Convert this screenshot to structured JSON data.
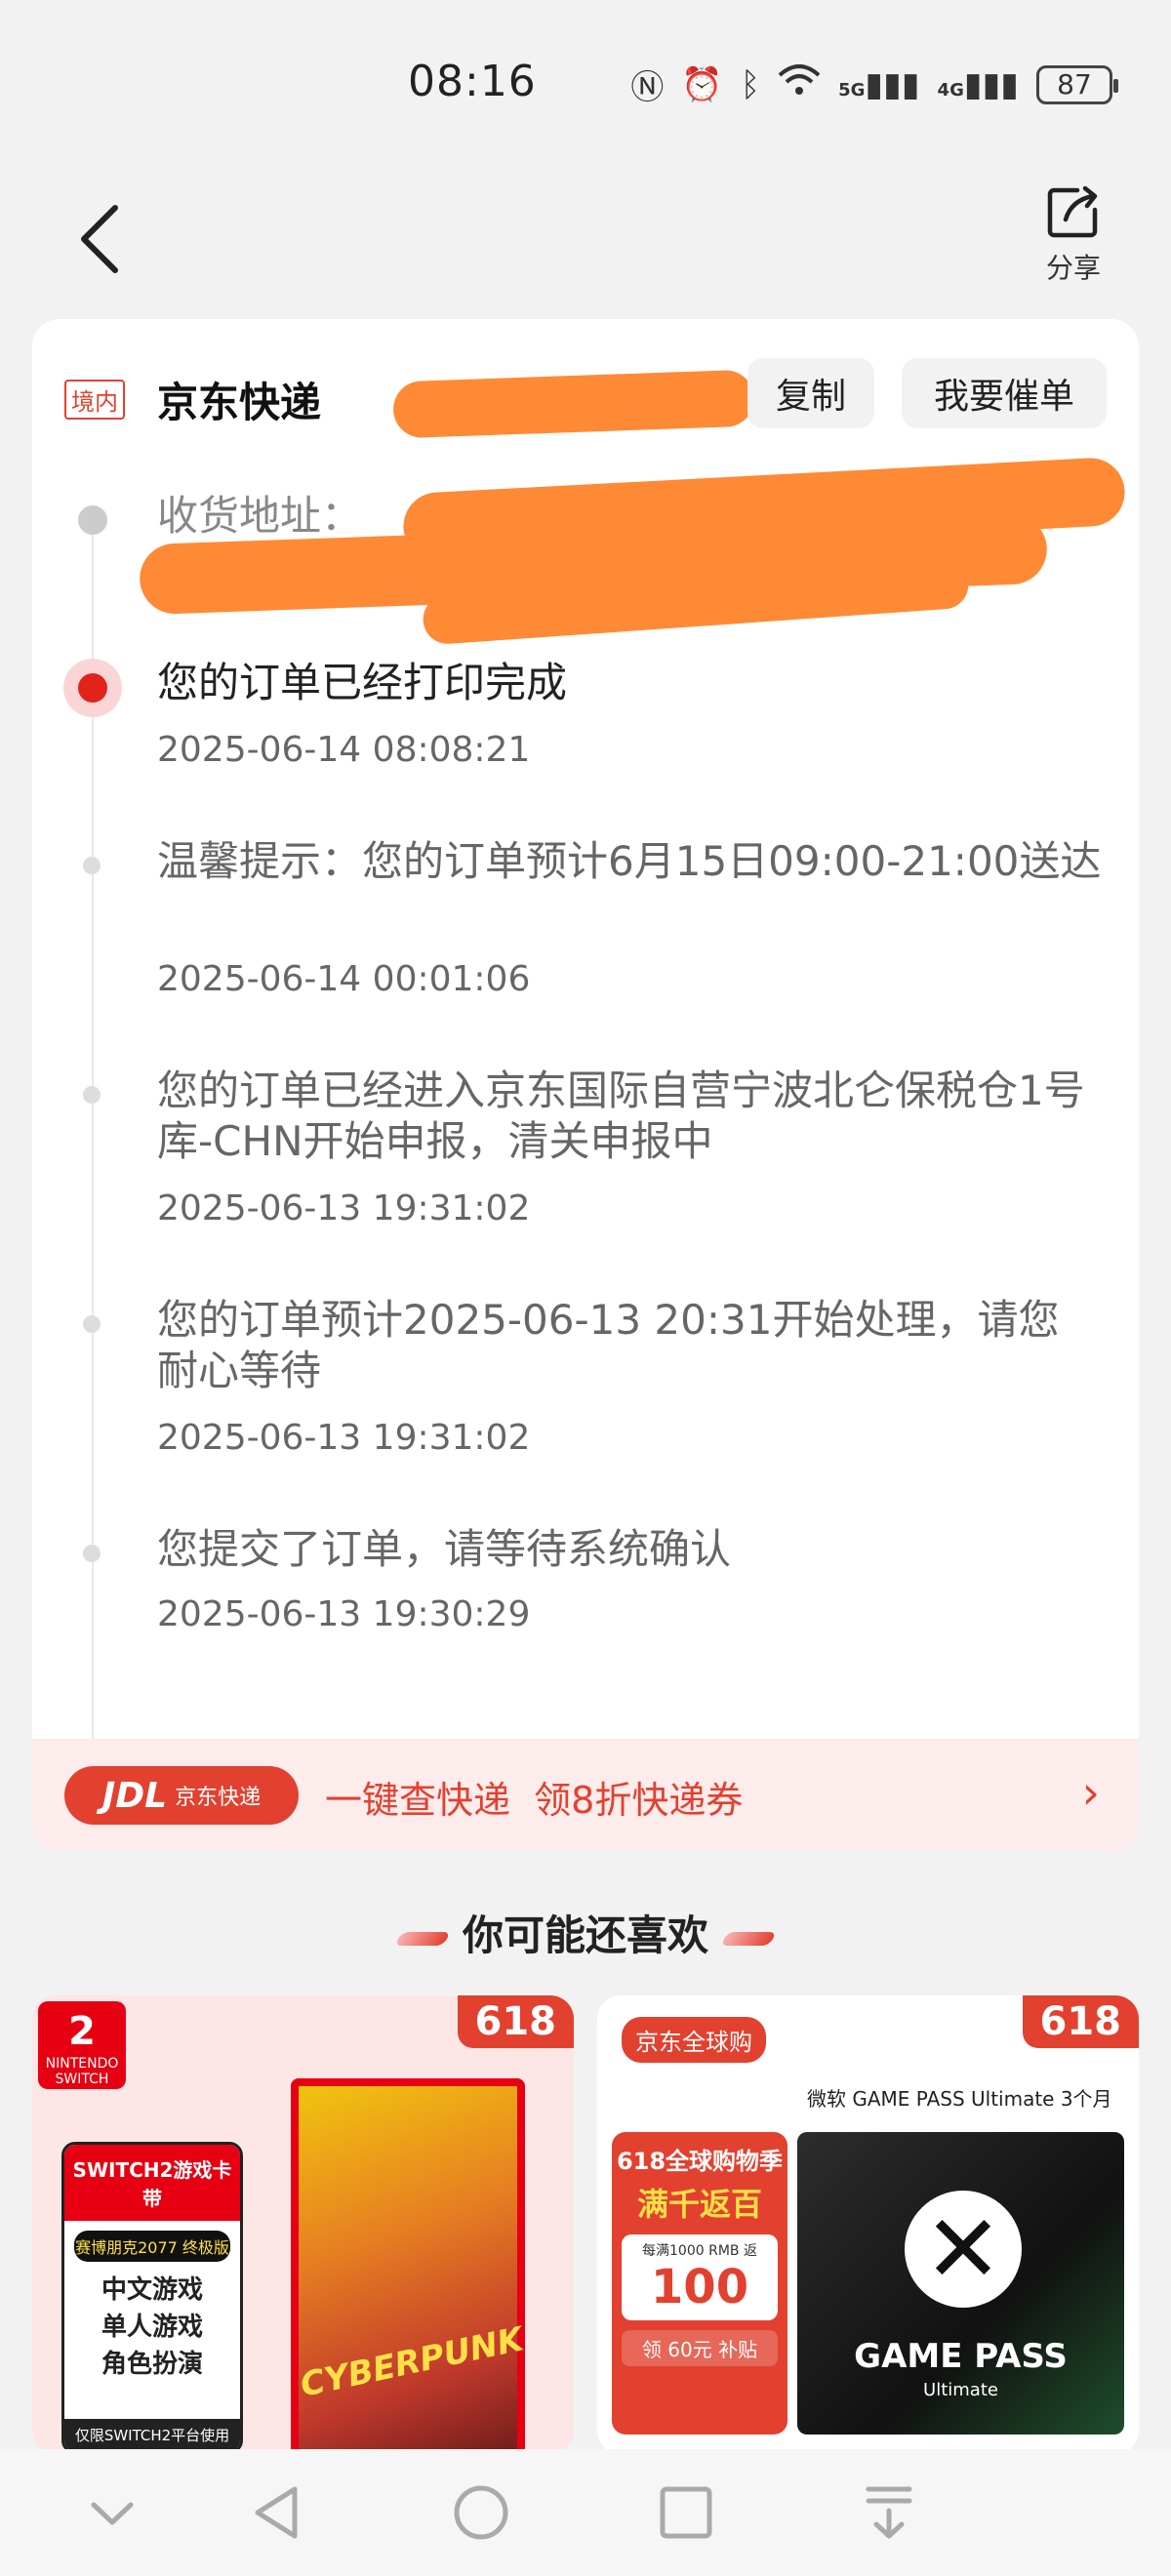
{
  "status_bar": {
    "time": "08:16",
    "battery": "87",
    "net1": "5G",
    "net2": "4G"
  },
  "header": {
    "share_label": "分享"
  },
  "courier": {
    "tag": "境内",
    "name": "京东快递",
    "copy_label": "复制",
    "urge_label": "我要催单"
  },
  "address": {
    "label": "收货地址："
  },
  "timeline": [
    {
      "text": "您的订单已经打印完成",
      "time": "2025-06-14 08:08:21"
    },
    {
      "text": "温馨提示：您的订单预计6月15日09:00-21:00送达",
      "time": "2025-06-14 00:01:06"
    },
    {
      "text": "您的订单已经进入京东国际自营宁波北仑保税仓1号库-CHN开始申报，清关申报中",
      "time": "2025-06-13 19:31:02"
    },
    {
      "text": "您的订单预计2025-06-13 20:31开始处理，请您耐心等待",
      "time": "2025-06-13 19:31:02"
    },
    {
      "text": "您提交了订单，请等待系统确认",
      "time": "2025-06-13 19:30:29"
    }
  ],
  "jdl_banner": {
    "logo_main": "JDL",
    "logo_sub": "京东快递",
    "text": "一键查快递  领8折快递券",
    "chevron": "›"
  },
  "recommend": {
    "title": "你可能还喜欢",
    "products": [
      {
        "badge": "618",
        "logo_num": "2",
        "logo_text": "NINTENDO SWITCH",
        "tag_head": "SWITCH2游戏卡带",
        "tag_pill": "赛博朋克2077 终极版",
        "tag_lines": [
          "中文游戏",
          "单人游戏",
          "角色扮演"
        ],
        "tag_foot": "仅限SWITCH2平台使用",
        "box_title": "CYBERPUNK"
      },
      {
        "badge": "618",
        "store_tag": "京东全球购",
        "title": "微软 GAME PASS Ultimate 3个月",
        "promo_l1": "618全球购物季",
        "promo_l2": "满千返百",
        "promo_big": "100",
        "promo_small": "每满1000 RMB 返",
        "promo_sub": "领 60元 补贴",
        "gp_name": "GAME PASS",
        "gp_sub": "Ultimate"
      }
    ]
  }
}
